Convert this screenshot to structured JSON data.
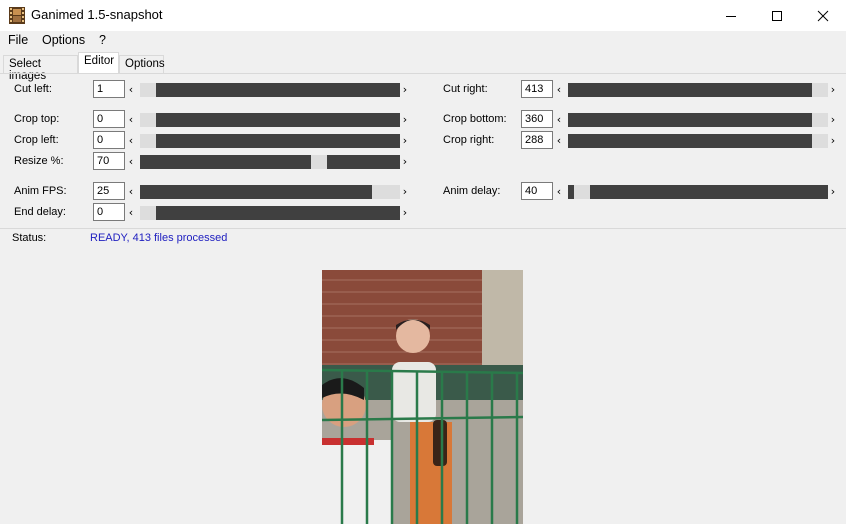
{
  "window": {
    "title": "Ganimed 1.5-snapshot",
    "controls": [
      "minimize-icon",
      "maximize-icon",
      "close-icon"
    ]
  },
  "menu": {
    "items": [
      "File",
      "Options",
      "?"
    ]
  },
  "tabs": [
    {
      "label": "Select images",
      "active": false
    },
    {
      "label": "Editor",
      "active": true
    },
    {
      "label": "Options",
      "active": false
    }
  ],
  "editor": {
    "cut_left": {
      "label": "Cut left:",
      "value": "1",
      "slider_fraction": 0.0
    },
    "cut_right": {
      "label": "Cut right:",
      "value": "413",
      "slider_fraction": 1.0
    },
    "crop_top": {
      "label": "Crop top:",
      "value": "0",
      "slider_fraction": 0.0
    },
    "crop_bottom": {
      "label": "Crop bottom:",
      "value": "360",
      "slider_fraction": 1.0
    },
    "crop_left": {
      "label": "Crop left:",
      "value": "0",
      "slider_fraction": 0.0
    },
    "crop_right": {
      "label": "Crop right:",
      "value": "288",
      "slider_fraction": 1.0
    },
    "resize": {
      "label": "Resize %:",
      "value": "70",
      "slider_fraction": 0.7
    },
    "anim_fps": {
      "label": "Anim FPS:",
      "value": "25",
      "slider_fraction": 0.95
    },
    "anim_delay": {
      "label": "Anim delay:",
      "value": "40",
      "slider_fraction": 0.05
    },
    "end_delay": {
      "label": "End delay:",
      "value": "0",
      "slider_fraction": 0.0
    }
  },
  "status": {
    "label": "Status:",
    "text": "READY, 413 files processed",
    "color": "#2020c0"
  },
  "preview": {
    "description_icon": "preview-image"
  }
}
